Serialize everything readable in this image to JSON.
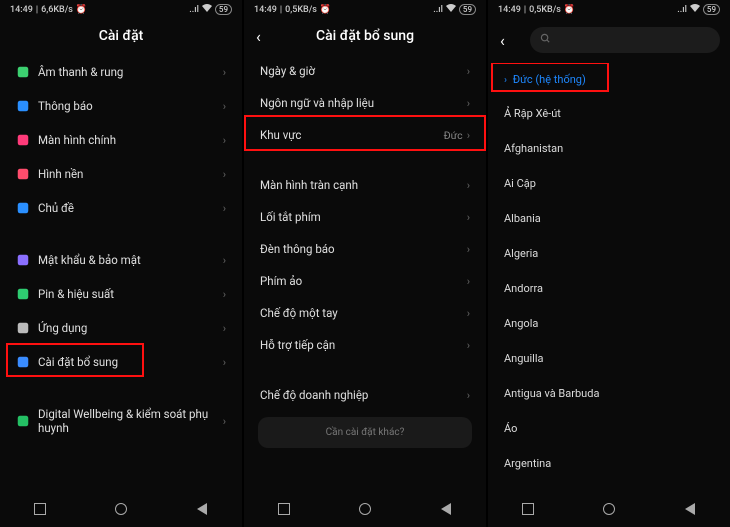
{
  "status": {
    "time": "14:49",
    "net1": "6,6KB/s",
    "net2": "0,5KB/s",
    "net3": "0,5KB/s",
    "alarm": "⏰",
    "signal": "📶",
    "wifi": "📶",
    "battery": "59"
  },
  "screen1": {
    "title": "Cài đặt",
    "items": [
      {
        "label": "Âm thanh & rung",
        "color": "#3cd070"
      },
      {
        "label": "Thông báo",
        "color": "#2a8fff"
      },
      {
        "label": "Màn hình chính",
        "color": "#ff3b7a"
      },
      {
        "label": "Hình nền",
        "color": "#ff4d6d"
      },
      {
        "label": "Chủ đề",
        "color": "#2a8fff"
      }
    ],
    "items2": [
      {
        "label": "Mật khẩu & bảo mật",
        "color": "#8a6fff"
      },
      {
        "label": "Pin & hiệu suất",
        "color": "#2ecc71"
      },
      {
        "label": "Ứng dụng",
        "color": "#bbb"
      },
      {
        "label": "Cài đặt bổ sung",
        "color": "#3a8cff",
        "highlight": true
      }
    ],
    "items3": [
      {
        "label": "Digital Wellbeing & kiểm soát phụ huynh",
        "color": "#24c064"
      }
    ]
  },
  "screen2": {
    "title": "Cài đặt bổ sung",
    "groups": [
      [
        {
          "label": "Ngày & giờ"
        },
        {
          "label": "Ngôn ngữ và nhập liệu"
        },
        {
          "label": "Khu vực",
          "value": "Đức",
          "highlight": true
        }
      ],
      [
        {
          "label": "Màn hình tràn cạnh"
        },
        {
          "label": "Lối tắt phím"
        },
        {
          "label": "Đèn thông báo"
        },
        {
          "label": "Phím ảo"
        },
        {
          "label": "Chế độ một tay"
        },
        {
          "label": "Hỗ trợ tiếp cận"
        }
      ],
      [
        {
          "label": "Chế độ doanh nghiệp"
        }
      ]
    ],
    "bottom_card": "Cần cài đặt khác?"
  },
  "screen3": {
    "system_label": "Đức (hệ thống)",
    "regions": [
      "Ả Rập Xê-út",
      "Afghanistan",
      "Ai Cập",
      "Albania",
      "Algeria",
      "Andorra",
      "Angola",
      "Anguilla",
      "Antigua và Barbuda",
      "Áo",
      "Argentina"
    ]
  }
}
